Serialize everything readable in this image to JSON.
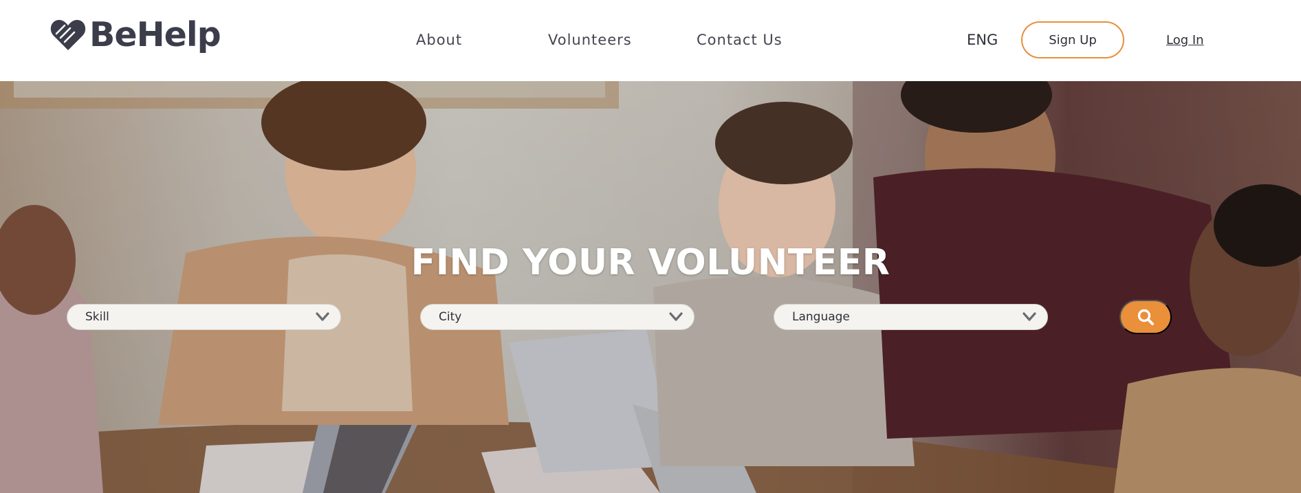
{
  "brand": {
    "name": "BeHelp",
    "accent_color": "#ea8f3a",
    "text_color": "#3c3d4b"
  },
  "nav": {
    "about": "About",
    "volunteers": "Volunteers",
    "contact": "Contact Us"
  },
  "header": {
    "language": "ENG",
    "signup_label": "Sign Up",
    "login_label": "Log In"
  },
  "hero": {
    "title": "FIND YOUR VOLUNTEER",
    "background_image": "people-working-around-table-photo",
    "filters": {
      "skill": {
        "label": "Skill",
        "icon": "chevron-down-icon"
      },
      "city": {
        "label": "City",
        "icon": "chevron-down-icon"
      },
      "language": {
        "label": "Language",
        "icon": "chevron-down-icon"
      }
    },
    "search_icon": "search-icon"
  }
}
